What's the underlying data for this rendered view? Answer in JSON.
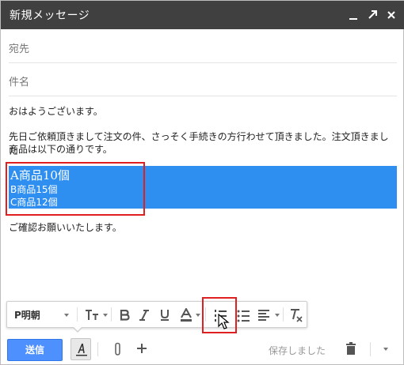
{
  "window": {
    "title": "新規メッセージ",
    "controls": [
      "minimize-icon",
      "expand-icon",
      "close-icon"
    ]
  },
  "fields": {
    "to_label": "宛先",
    "subject_label": "件名"
  },
  "message": {
    "greeting": "おはようございます。",
    "paragraph_line1": "先日ご依頼頂きまして注文の件、さっそく手続きの方行わせて頂きました。注文頂きました",
    "paragraph_line2": "商品は以下の通りです。",
    "selected_lines": [
      "A商品10個",
      "B商品15個",
      "C商品12個"
    ],
    "closing": "ご確認お願いいたします。"
  },
  "format_toolbar": {
    "font_name": "P明朝",
    "items": [
      "font-select",
      "text-size-icon",
      "bold-icon",
      "italic-icon",
      "underline-icon",
      "text-color-icon",
      "numbered-list-icon",
      "bulleted-list-icon",
      "align-icon",
      "remove-formatting-icon"
    ]
  },
  "bottom_bar": {
    "send_label": "送信",
    "saved_status": "保存しました"
  },
  "colors": {
    "titlebar": "#404040",
    "selection": "#2f8ff0",
    "send_button": "#4d90fe",
    "highlight_box": "#e02020"
  }
}
